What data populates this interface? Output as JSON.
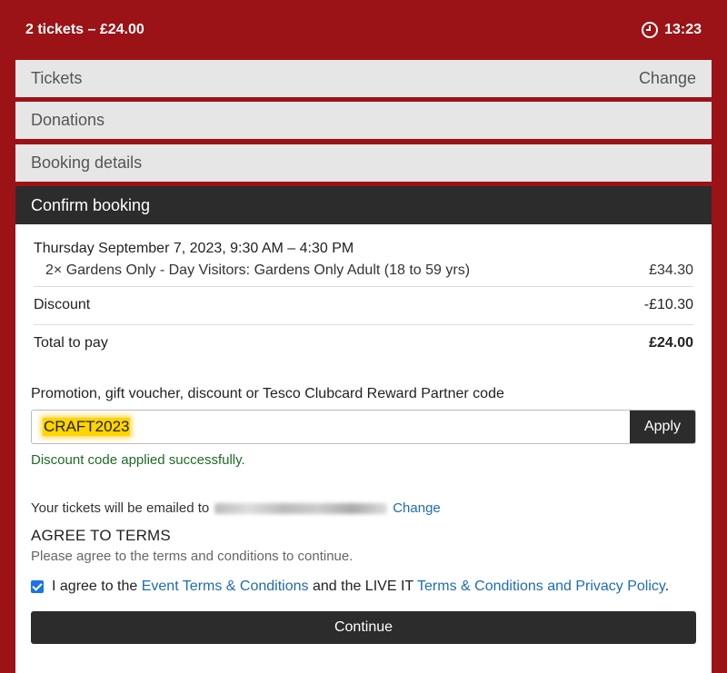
{
  "header": {
    "summary": "2 tickets – £24.00",
    "timer": "13:23"
  },
  "steps": {
    "tickets": {
      "label": "Tickets",
      "action": "Change"
    },
    "donations": {
      "label": "Donations"
    },
    "booking_details": {
      "label": "Booking details"
    },
    "confirm": {
      "label": "Confirm booking"
    }
  },
  "summary": {
    "date": "Thursday September 7, 2023, 9:30 AM – 4:30 PM",
    "item_label": "2× Gardens Only - Day Visitors: Gardens Only Adult (18 to 59 yrs)",
    "item_price": "£34.30",
    "discount_label": "Discount",
    "discount_value": "-£10.30",
    "total_label": "Total to pay",
    "total_value": "£24.00"
  },
  "promo": {
    "label": "Promotion, gift voucher, discount or Tesco Clubcard Reward Partner code",
    "value": "CRAFT2023",
    "apply_label": "Apply",
    "success": "Discount code applied successfully."
  },
  "email": {
    "prefix": "Your tickets will be emailed to",
    "change_label": "Change"
  },
  "terms": {
    "title": "AGREE TO TERMS",
    "subtitle": "Please agree to the terms and conditions to continue.",
    "text1": "I agree to the ",
    "link1": "Event Terms & Conditions",
    "text2": " and the LIVE IT ",
    "link2": "Terms & Conditions and Privacy Policy",
    "text3": ".",
    "checked": true
  },
  "continue_label": "Continue",
  "colors": {
    "brand": "#9b1316",
    "dark": "#2c2c2c",
    "link": "#1f6bb5",
    "success": "#1e6b24"
  }
}
